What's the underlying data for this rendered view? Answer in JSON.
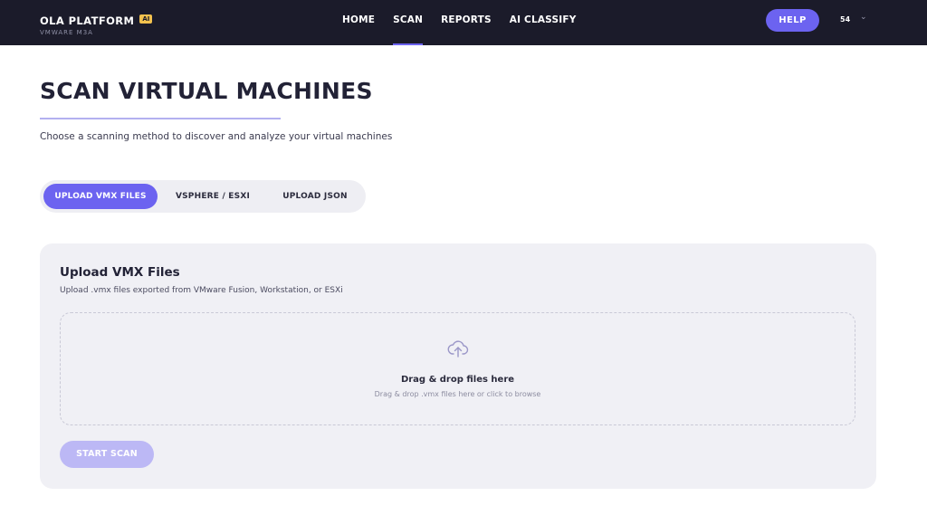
{
  "brand": {
    "title": "OLA PLATFORM",
    "badge": "AI",
    "subtitle": "VMWARE M3A"
  },
  "nav": {
    "items": [
      {
        "label": "HOME"
      },
      {
        "label": "SCAN"
      },
      {
        "label": "REPORTS"
      },
      {
        "label": "AI CLASSIFY"
      }
    ],
    "active": "SCAN"
  },
  "header_actions": {
    "help_label": "HELP",
    "user_label": "54",
    "chevron": "⌄"
  },
  "page": {
    "title": "SCAN VIRTUAL MACHINES",
    "subtitle": "Choose a scanning method to discover and analyze your virtual machines"
  },
  "tabs": [
    {
      "label": "UPLOAD VMX FILES"
    },
    {
      "label": "VSPHERE / ESXI"
    },
    {
      "label": "UPLOAD JSON"
    }
  ],
  "upload": {
    "title": "Upload VMX Files",
    "subtitle": "Upload .vmx files exported from VMware Fusion, Workstation, or ESXi",
    "drop_title": "Drag & drop files here",
    "drop_sub": "Drag & drop .vmx files here or click to browse",
    "start_label": "START SCAN",
    "icon": "cloud-upload-icon"
  },
  "colors": {
    "accent": "#6c63f0",
    "topbar": "#1b1b2a",
    "badge": "#f2c14e",
    "disabled_button": "#bcb8f5"
  }
}
